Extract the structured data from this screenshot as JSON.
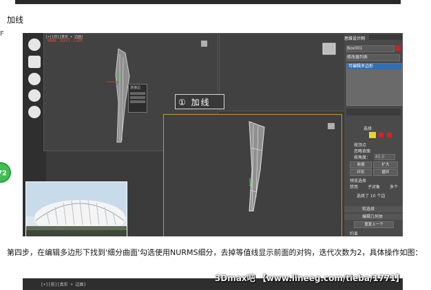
{
  "edge_char": "F",
  "section_heading": "加线",
  "badge_number": "72",
  "viewport": {
    "top_label": "[+][前][真实 + 边面]",
    "watermark": "WWW.3DXY.COM",
    "annotation": "① 加线",
    "popup_title": "连接边"
  },
  "panel": {
    "header": "思维设计网",
    "object_name": "Box001",
    "modifier_list": "修改器列表",
    "stack_item": "可编辑多边形",
    "rollout_select": "选择",
    "by_vertex": "按顶点",
    "ignore_backface": "忽略背面",
    "by_angle": "按角度：",
    "angle_value": "45.0",
    "shrink": "收缩",
    "grow": "扩大",
    "ring": "环形",
    "loop": "循环",
    "preview_select": "预览选择",
    "disabled": "禁用",
    "sub_object": "子对象",
    "multi": "多个",
    "selected_count": "选择了 10 个边",
    "soft_selection": "软选择",
    "edit_geometry": "编辑几何体",
    "repeat_last": "重复上一个",
    "constraints": "约束"
  },
  "instruction_paragraph": "第四步，在编辑多边形下找到'细分曲面'勾选使用NURMS细分，去掉等值线显示前面的对钩，迭代次数为2，具体操作如图：",
  "second_shot_label": "[+][前][真实 + 边面]",
  "bottom_watermark": "3Dmax吧 【www.lineeg.com/tieba/1771】"
}
